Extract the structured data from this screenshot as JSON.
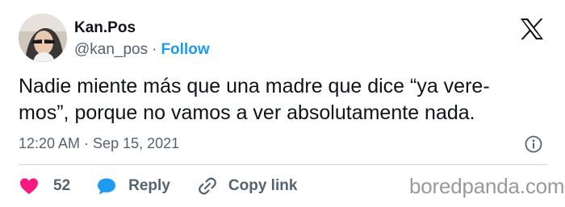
{
  "author": {
    "display_name": "Kan.Pos",
    "handle": "@kan_pos",
    "separator": "·",
    "follow_label": "Follow"
  },
  "tweet": {
    "text": "Nadie miente más que una madre que dice “ya vere-\nmos”, porque no vamos a ver absolutamente nada.",
    "timestamp": "12:20 AM · Sep 15, 2021"
  },
  "actions": {
    "like_count": "52",
    "reply_label": "Reply",
    "copy_link_label": "Copy link"
  },
  "watermark": "boredpanda.com",
  "colors": {
    "text": "#0f1419",
    "secondary": "#536471",
    "link": "#1d9bf0",
    "like": "#f91880",
    "reply": "#1d9bf0",
    "divider": "#cfd9de",
    "watermark": "#9a9a9a"
  },
  "icons": [
    "x-logo-icon",
    "info-icon",
    "heart-icon",
    "reply-bubble-icon",
    "link-icon"
  ]
}
